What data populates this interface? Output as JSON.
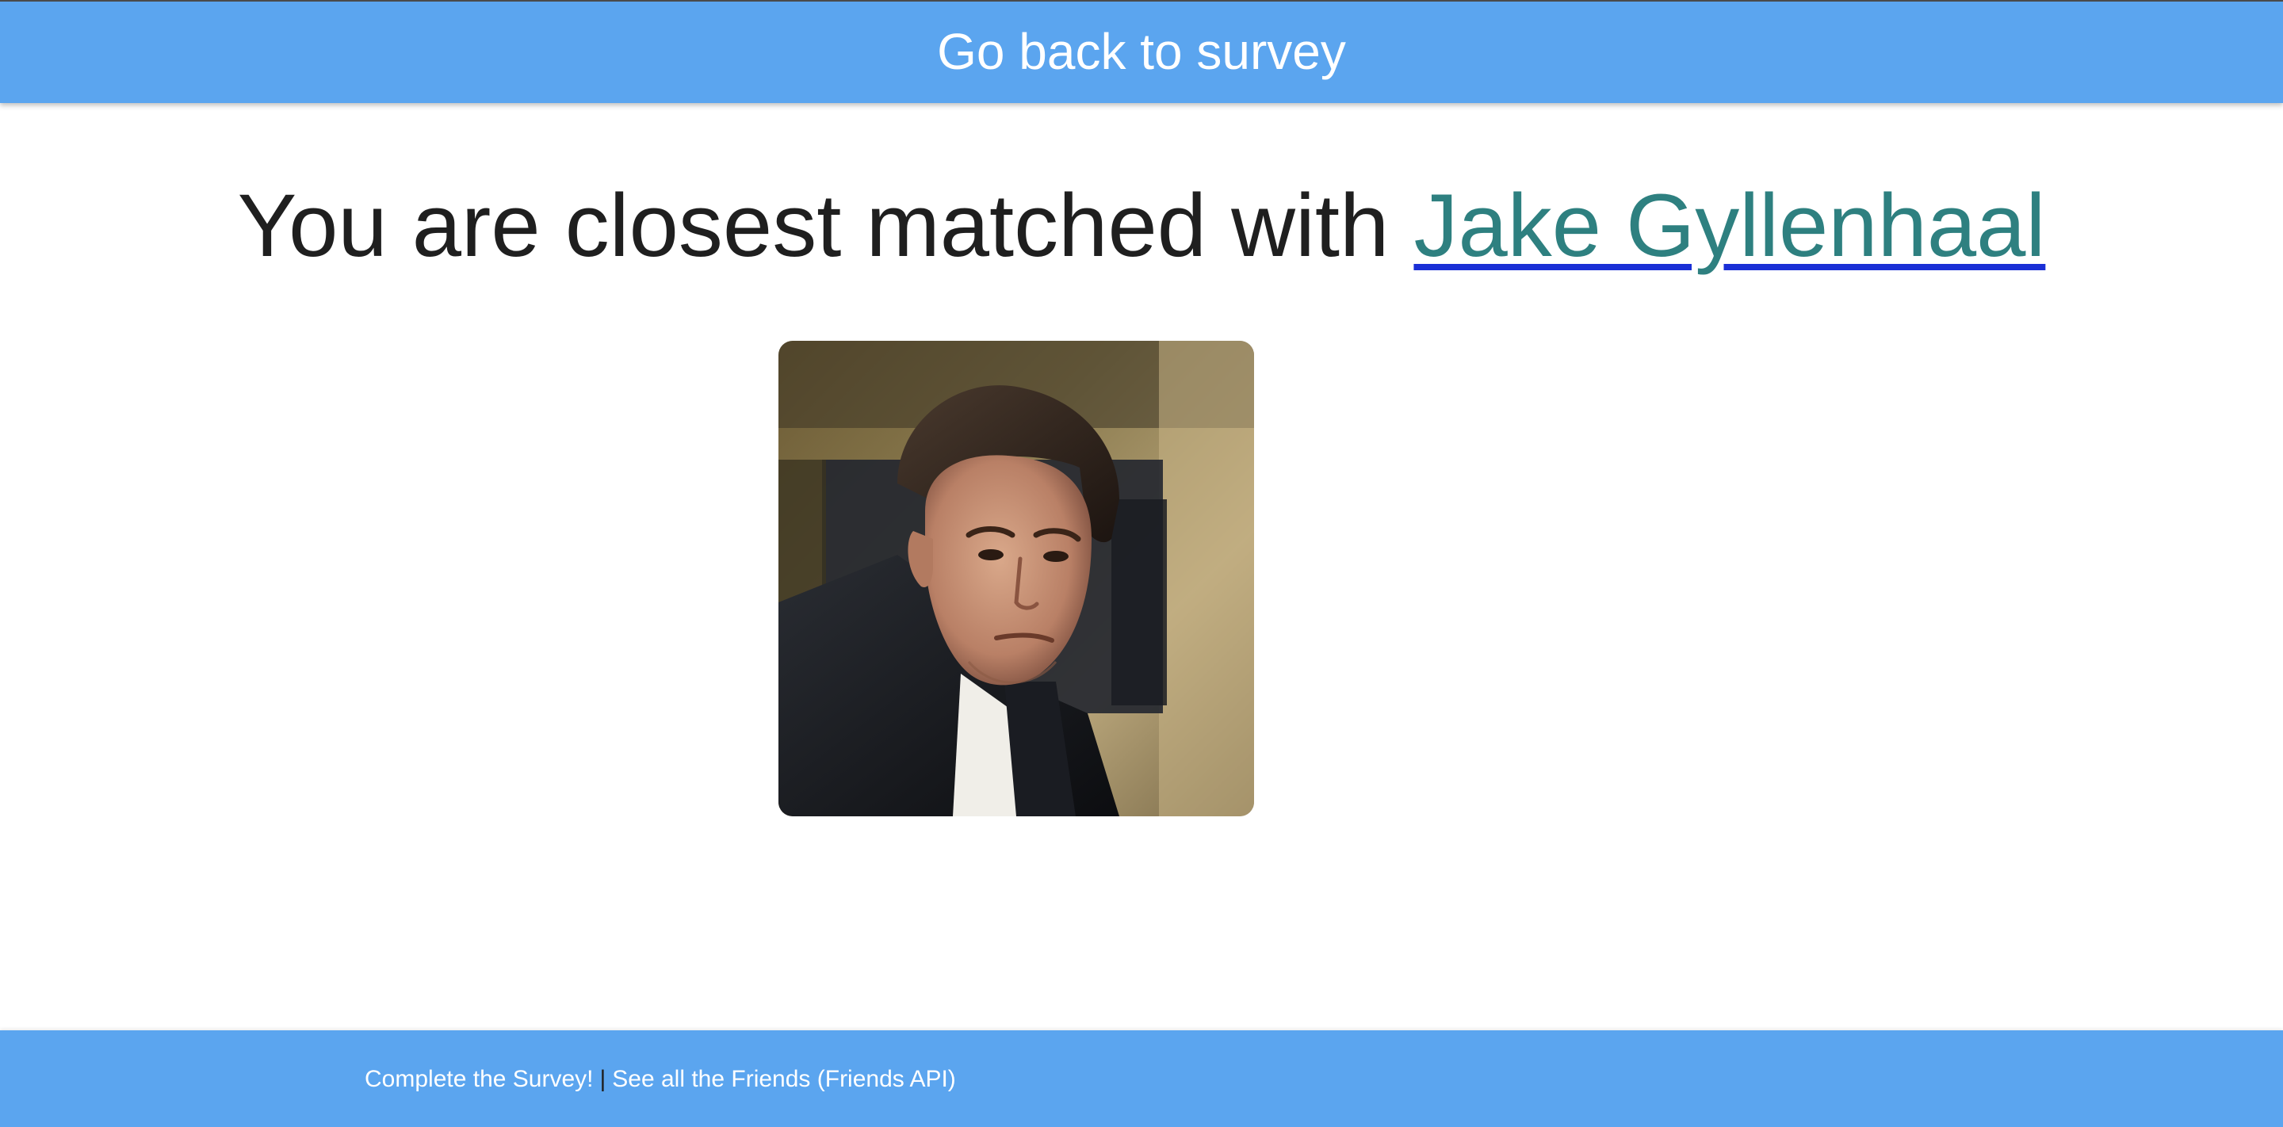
{
  "header": {
    "back_link": "Go back to survey"
  },
  "result": {
    "prefix": "You are closest matched with",
    "match_name": "Jake Gyllenhaal",
    "photo_alt": "Jake Gyllenhaal"
  },
  "footer": {
    "survey_link": "Complete the Survey!",
    "separator": "|",
    "friends_link": "See all the Friends (Friends API)"
  },
  "colors": {
    "bar_background": "#5ba5ef",
    "link_text": "#2e8080",
    "link_underline": "#1a2fd6",
    "body_text": "#1f1f1f"
  }
}
